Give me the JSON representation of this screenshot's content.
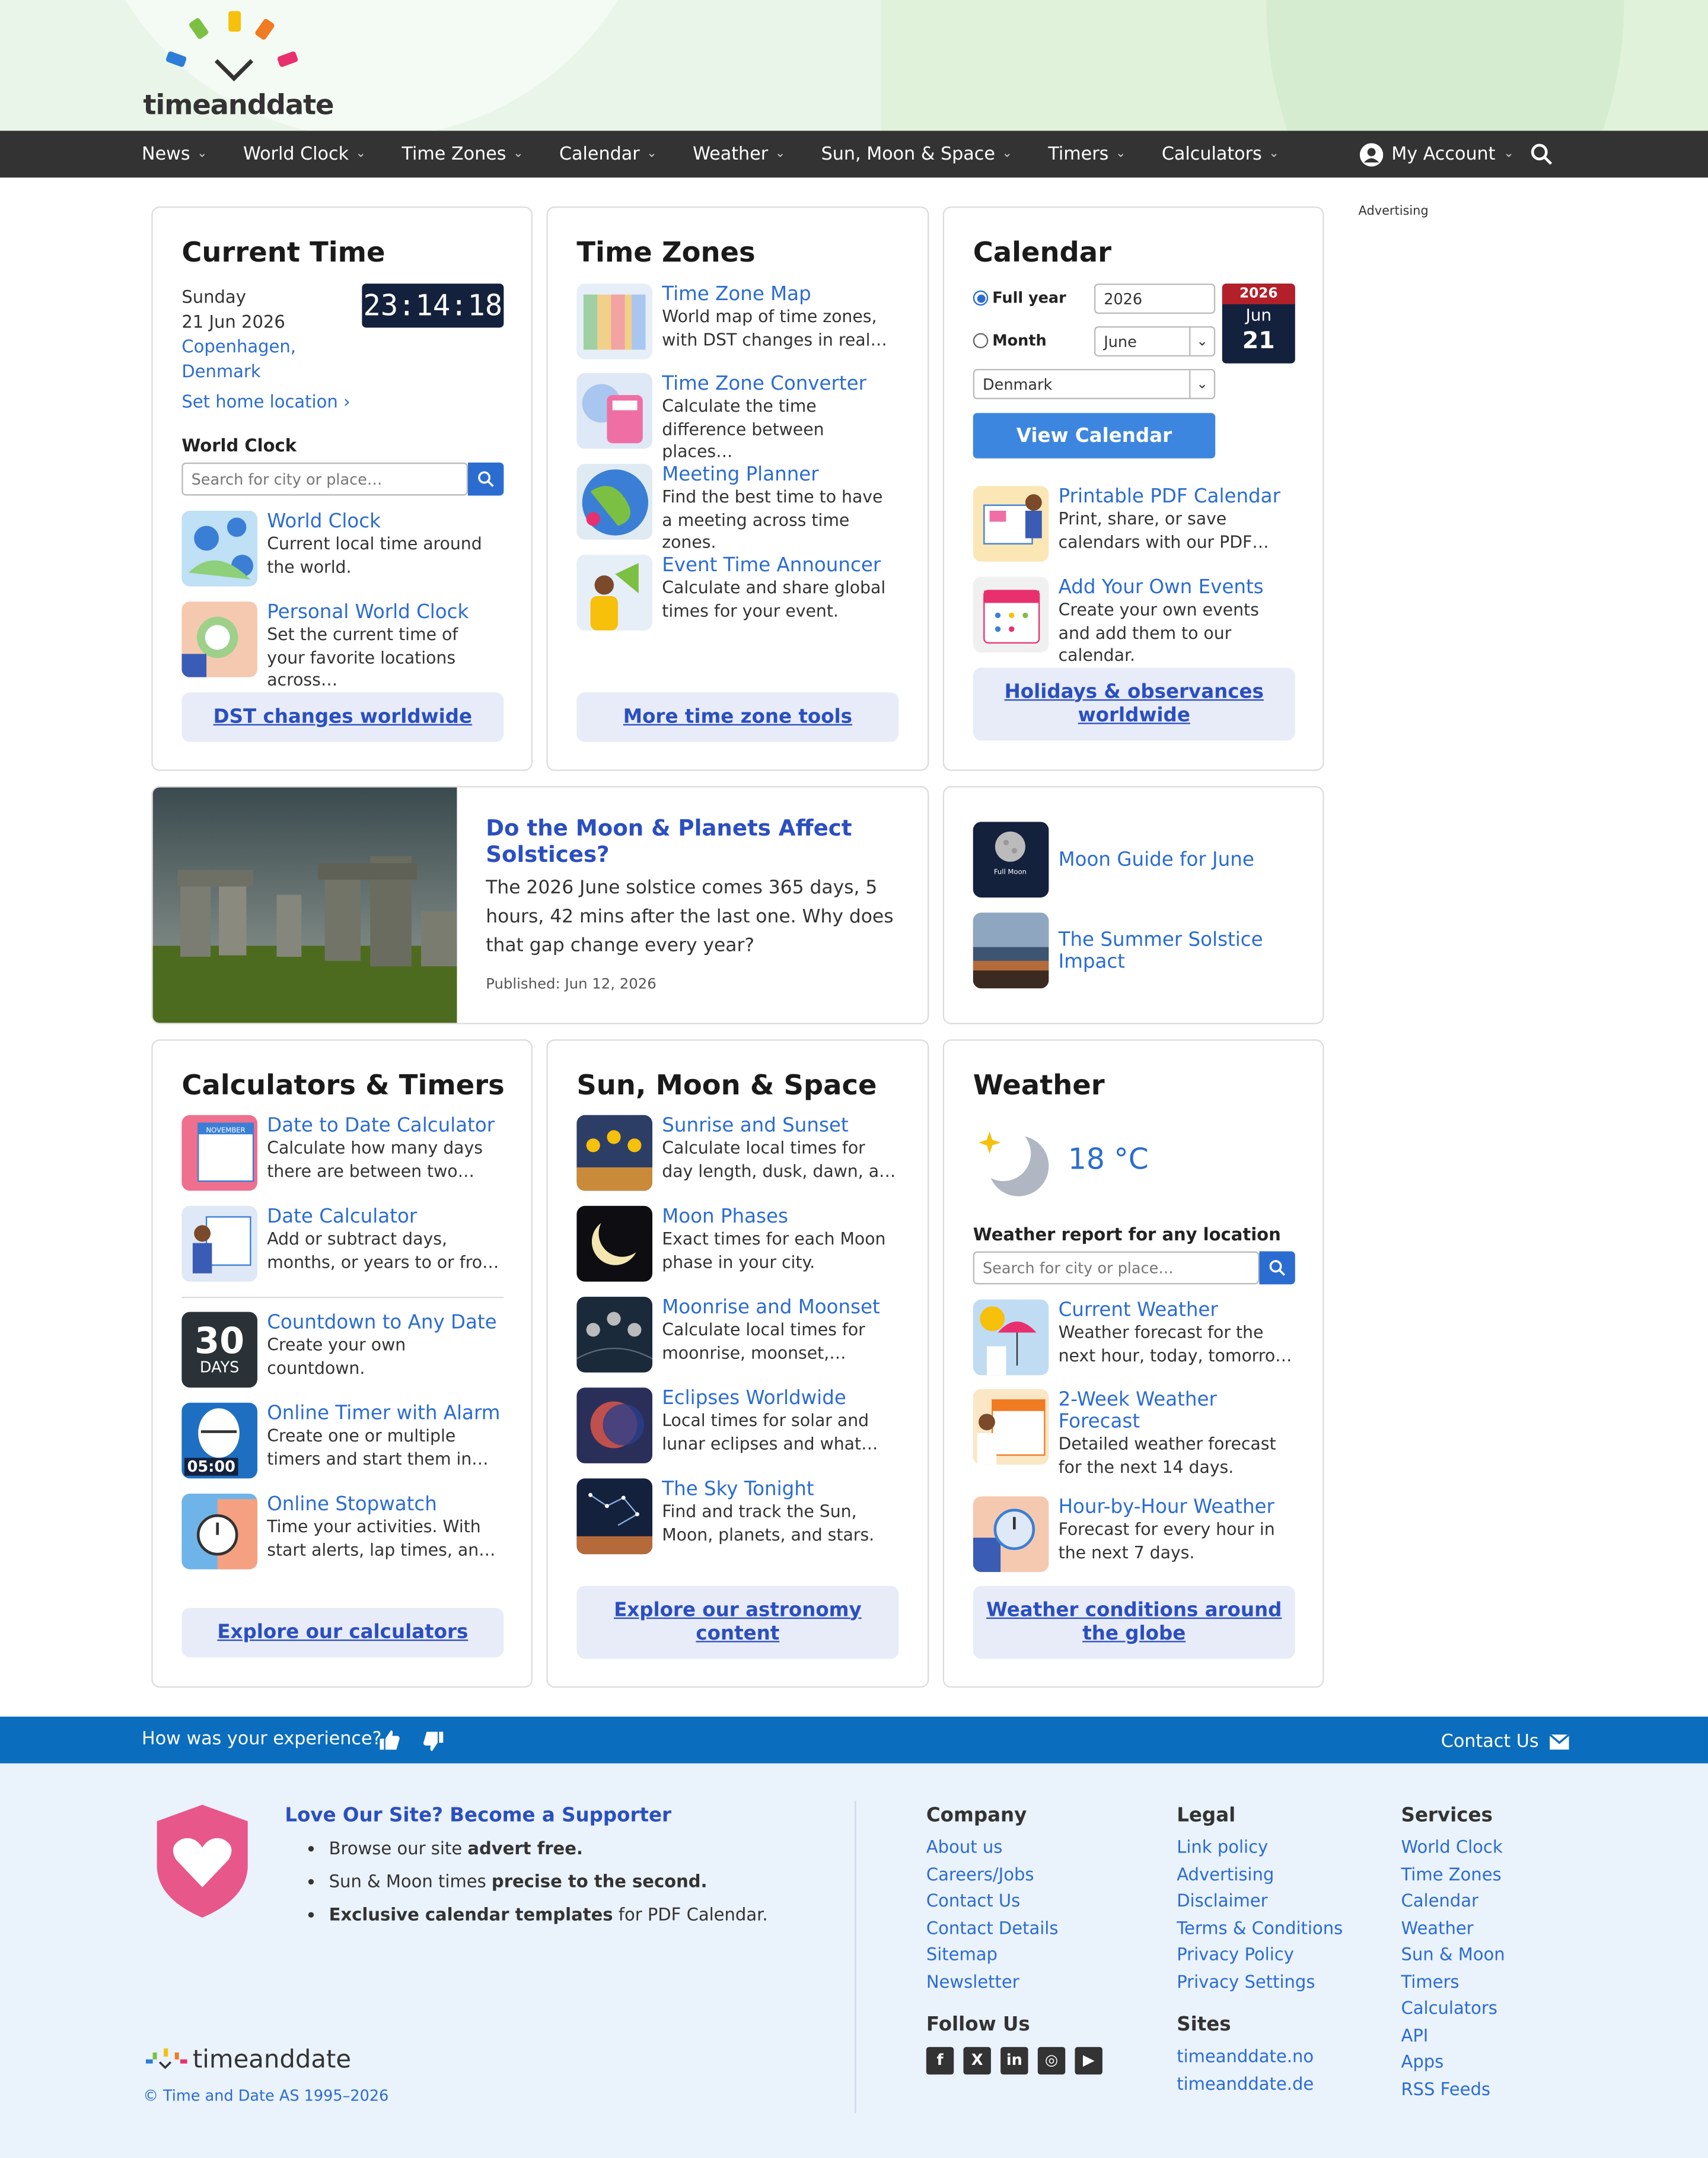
{
  "brand": {
    "name": "timeanddate",
    "copyright": "© Time and Date AS 1995–2026"
  },
  "nav": {
    "items": [
      "News",
      "World Clock",
      "Time Zones",
      "Calendar",
      "Weather",
      "Sun, Moon & Space",
      "Timers",
      "Calculators"
    ],
    "account": "My Account"
  },
  "advertising": "Advertising",
  "current_time": {
    "title": "Current Time",
    "day": "Sunday",
    "date": "21 Jun 2026",
    "location": "Copenhagen, Denmark",
    "clock": "23:14:18",
    "set_home": "Set home location",
    "world_clock_label": "World Clock",
    "search_placeholder": "Search for city or place…",
    "items": [
      {
        "title": "World Clock",
        "desc": "Current local time around the world."
      },
      {
        "title": "Personal World Clock",
        "desc": "Set the current time of your favorite locations across…"
      }
    ],
    "button": "DST changes worldwide"
  },
  "time_zones": {
    "title": "Time Zones",
    "items": [
      {
        "title": "Time Zone Map",
        "desc": "World map of time zones, with DST changes in real…"
      },
      {
        "title": "Time Zone Converter",
        "desc": "Calculate the time difference between places…"
      },
      {
        "title": "Meeting Planner",
        "desc": "Find the best time to have a meeting across time zones."
      },
      {
        "title": "Event Time Announcer",
        "desc": "Calculate and share global times for your event."
      }
    ],
    "button": "More time zone tools"
  },
  "calendar": {
    "title": "Calendar",
    "full_year": "Full year",
    "month": "Month",
    "year_value": "2026",
    "month_value": "June",
    "country_value": "Denmark",
    "badge_year": "2026",
    "badge_month": "Jun",
    "badge_day": "21",
    "view_button": "View Calendar",
    "items": [
      {
        "title": "Printable PDF Calendar",
        "desc": "Print, share, or save calendars with our PDF…"
      },
      {
        "title": "Add Your Own Events",
        "desc": "Create your own events and add them to our calendar."
      }
    ],
    "button": "Holidays & observances worldwide"
  },
  "article": {
    "title": "Do the Moon & Planets Affect Solstices?",
    "body": "The 2026 June solstice comes 365 days, 5 hours, 42 mins after the last one. Why does that gap change every year?",
    "published": "Published: Jun 12, 2026"
  },
  "side_links": [
    {
      "title": "Moon Guide for June",
      "thumb_text": "Full Moon"
    },
    {
      "title": "The Summer Solstice Impact"
    }
  ],
  "calculators": {
    "title": "Calculators & Timers",
    "items": [
      {
        "title": "Date to Date Calculator",
        "desc": "Calculate how many days there are between two…",
        "thumb": "NOVEMBER"
      },
      {
        "title": "Date Calculator",
        "desc": "Add or subtract days, months, or years to or fro…"
      },
      {
        "title": "Countdown to Any Date",
        "desc": "Create your own countdown.",
        "thumb": "30",
        "thumb2": "DAYS"
      },
      {
        "title": "Online Timer with Alarm",
        "desc": "Create one or multiple timers and start them in…",
        "thumb": "05:00"
      },
      {
        "title": "Online Stopwatch",
        "desc": "Time your activities. With start alerts, lap times, an…"
      }
    ],
    "button": "Explore our calculators"
  },
  "astro": {
    "title": "Sun, Moon & Space",
    "items": [
      {
        "title": "Sunrise and Sunset",
        "desc": "Calculate local times for day length, dusk, dawn, a…"
      },
      {
        "title": "Moon Phases",
        "desc": "Exact times for each Moon phase in your city."
      },
      {
        "title": "Moonrise and Moonset",
        "desc": "Calculate local times for moonrise, moonset,…"
      },
      {
        "title": "Eclipses Worldwide",
        "desc": "Local times for solar and lunar eclipses and what…"
      },
      {
        "title": "The Sky Tonight",
        "desc": "Find and track the Sun, Moon, planets, and stars."
      }
    ],
    "button": "Explore our astronomy content"
  },
  "weather": {
    "title": "Weather",
    "temp": "18 °C",
    "report_label": "Weather report for any location",
    "search_placeholder": "Search for city or place…",
    "items": [
      {
        "title": "Current Weather",
        "desc": "Weather forecast for the next hour, today, tomorro…"
      },
      {
        "title": "2-Week Weather Forecast",
        "desc": "Detailed weather forecast for the next 14 days."
      },
      {
        "title": "Hour-by-Hour Weather",
        "desc": "Forecast for every hour in the next 7 days."
      }
    ],
    "button": "Weather conditions around the globe"
  },
  "feedback": {
    "question": "How was your experience?",
    "contact": "Contact Us"
  },
  "footer": {
    "supporter_title": "Love Our Site? Become a Supporter",
    "bullets": [
      {
        "pre": "Browse our site ",
        "bold": "advert free.",
        "post": ""
      },
      {
        "pre": "Sun & Moon times ",
        "bold": "precise to the second.",
        "post": ""
      },
      {
        "pre": "",
        "bold": "Exclusive calendar templates",
        "post": " for PDF Calendar."
      }
    ],
    "company": {
      "title": "Company",
      "links": [
        "About us",
        "Careers/Jobs",
        "Contact Us",
        "Contact Details",
        "Sitemap",
        "Newsletter"
      ]
    },
    "legal": {
      "title": "Legal",
      "links": [
        "Link policy",
        "Advertising",
        "Disclaimer",
        "Terms & Conditions",
        "Privacy Policy",
        "Privacy Settings"
      ]
    },
    "services": {
      "title": "Services",
      "links": [
        "World Clock",
        "Time Zones",
        "Calendar",
        "Weather",
        "Sun & Moon",
        "Timers",
        "Calculators",
        "API",
        "Apps",
        "RSS Feeds"
      ]
    },
    "follow": {
      "title": "Follow Us"
    },
    "sites": {
      "title": "Sites",
      "links": [
        "timeanddate.no",
        "timeanddate.de"
      ]
    }
  }
}
